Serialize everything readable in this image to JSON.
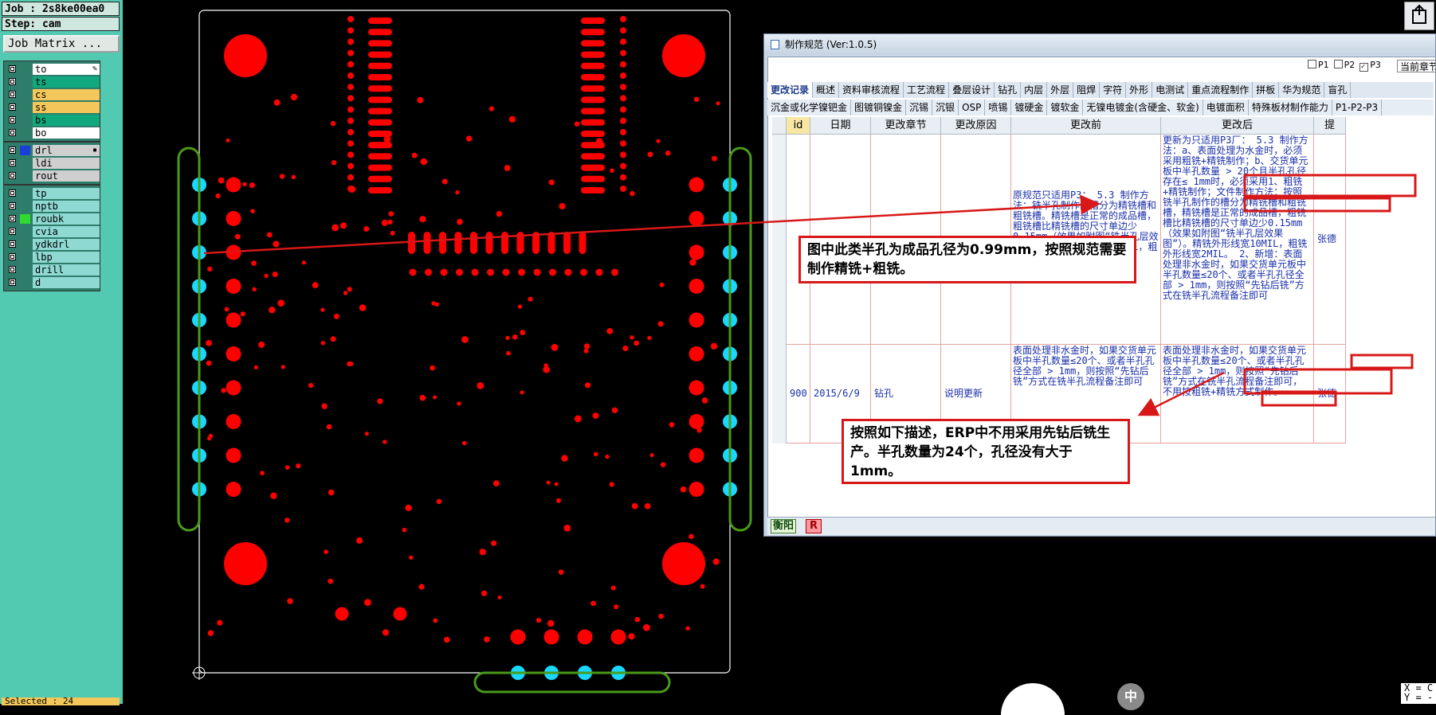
{
  "app": {
    "job_label": "Job : 2s8ke00ea0",
    "step_label": "Step: cam",
    "job_matrix_button": "Job Matrix ...",
    "selected_label": "Selected : 24"
  },
  "layers_group1": [
    {
      "name": "to",
      "color": "#ffffff",
      "flag": "✎"
    },
    {
      "name": "ts",
      "color": "#12a87d",
      "flag": ""
    },
    {
      "name": "cs",
      "color": "#f3c75a",
      "flag": ""
    },
    {
      "name": "ss",
      "color": "#f3c75a",
      "flag": ""
    },
    {
      "name": "bs",
      "color": "#12a87d",
      "flag": ""
    },
    {
      "name": "bo",
      "color": "#ffffff",
      "flag": ""
    }
  ],
  "layers_group2": [
    {
      "name": "drl",
      "color": "#cfcfcf",
      "flag": "▪"
    },
    {
      "name": "ldi",
      "color": "#cfcfcf",
      "flag": ""
    },
    {
      "name": "rout",
      "color": "#cfcfcf",
      "flag": ""
    }
  ],
  "layers_group3": [
    {
      "name": "tp",
      "color": "#8fd9d3",
      "flag": ""
    },
    {
      "name": "nptb",
      "color": "#8fd9d3",
      "flag": ""
    },
    {
      "name": "roubk",
      "color": "#8fd9d3",
      "flag": ""
    },
    {
      "name": "cvia",
      "color": "#8fd9d3",
      "flag": ""
    },
    {
      "name": "ydkdrl",
      "color": "#8fd9d3",
      "flag": ""
    },
    {
      "name": "lbp",
      "color": "#8fd9d3",
      "flag": ""
    },
    {
      "name": "drill",
      "color": "#8fd9d3",
      "flag": ""
    },
    {
      "name": "d",
      "color": "#8fd9d3",
      "flag": ""
    }
  ],
  "spec_window": {
    "title": "制作规范 (Ver:1.0.5)",
    "plant_options": [
      {
        "label": "P1",
        "checked": false
      },
      {
        "label": "P2",
        "checked": false
      },
      {
        "label": "P3",
        "checked": true
      }
    ],
    "section_dropdown": "当前章节",
    "tabs_row1": [
      "更改记录",
      "概述",
      "资料审核流程",
      "工艺流程",
      "叠层设计",
      "钻孔",
      "内层",
      "外层",
      "阻焊",
      "字符",
      "外形",
      "电测试",
      "重点流程制作",
      "拼板",
      "华为规范",
      "盲孔"
    ],
    "active_tab": "更改记录",
    "tabs_row2": [
      "沉金或化学镍钯金",
      "图镀铜镍金",
      "沉锡",
      "沉银",
      "OSP",
      "喷锡",
      "镀硬金",
      "镀软金",
      "无镍电镀金(含硬金、软金)",
      "电镀面积",
      "特殊板材制作能力",
      "P1-P2-P3"
    ],
    "columns": [
      "id",
      "日期",
      "更改章节",
      "更改原因",
      "更改前",
      "更改后",
      "提"
    ],
    "rows": [
      {
        "id": "",
        "date": "",
        "section": "",
        "reason": "",
        "before": "原规范只适用P3： 5.3 制作方法：铣半孔制作的槽分为精铣槽和粗铣槽。精铣槽是正常的成品槽，粗铣槽比精铣槽的尺寸单边少0.15mm（效果如附图“铣半孔层效果图”）。精铣外形线宽10MIL，粗铣外形线宽2MIL。",
        "after": "更新为只适用P3厂： 5.3 制作方法：a、表面处理为水金时，必须采用粗铣+精铣制作；b、交货单元板中半孔数量 > 20个且半孔孔径存在≤ 1mm时，必须采用1、粗铣+精铣制作；文件制作方法：按照铣半孔制作的槽分为精铣槽和粗铣槽，精铣槽是正常的成品槽，粗铣槽比精铣槽的尺寸单边少0.15mm（效果如附图“铣半孔层效果图”）。精铣外形线宽10MIL，粗铣外形线宽2MIL。 2、新增：表面处理非水金时，如果交货单元板中半孔数量≤20个、或者半孔孔径全部 > 1mm，则按照“先钻后铣”方式在铣半孔流程备注即可",
        "proposer": "张德"
      },
      {
        "id": "900",
        "date": "2015/6/9",
        "section": "钻孔",
        "reason": "说明更新",
        "before": "表面处理非水金时，如果交货单元板中半孔数量≤20个、或者半孔孔径全部 > 1mm，则按照“先钻后铣”方式在铣半孔流程备注即可",
        "after": "表面处理非水金时，如果交货单元板中半孔数量≤20个、或者半孔孔径全部 > 1mm，则按照“先钻后铣”方式在铣半孔流程备注即可，不用按粗铣+精铣方式制作。",
        "proposer": "张德"
      }
    ],
    "status_plant": "衡阳",
    "status_badge": "R"
  },
  "callouts": {
    "first": "图中此类半孔为成品孔径为0.99mm，按照规范需要制作精铣+粗铣。",
    "second": "按照如下描述，ERP中不用采用先钻后铣生产。半孔数量为24个，孔径没有大于1mm。"
  },
  "ime_label": "中",
  "coord_readout": "X = C\nY = -",
  "colors": {
    "board_outline": "#ffffff",
    "pad": "#ff0000",
    "halfhole": "#18d8ff",
    "rout": "#4a9a1a",
    "annotation": "#d81818"
  }
}
